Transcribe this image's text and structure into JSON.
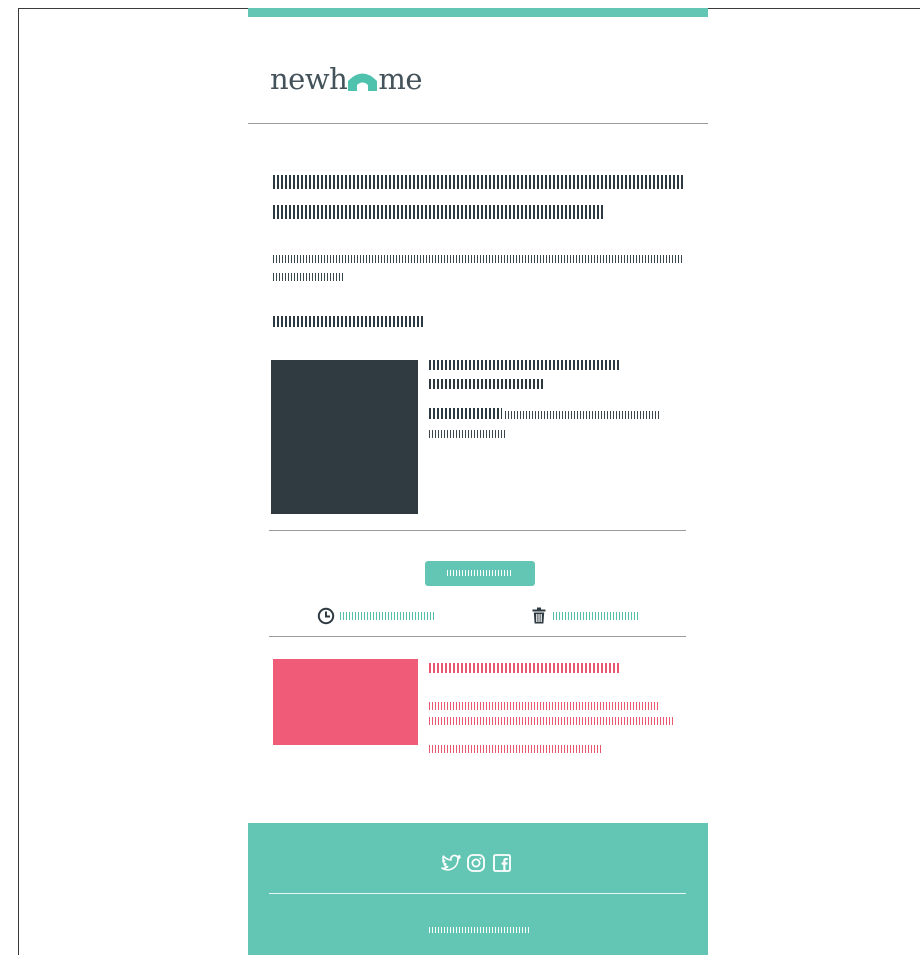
{
  "brand": {
    "logo_prefix": "newh",
    "logo_suffix": "me",
    "logo_icon": "house-icon",
    "accent_color": "#63c5b3",
    "dark_color": "#2f3a41",
    "promo_color": "#f05c78"
  },
  "email": {
    "headline_line1": "",
    "headline_line2": "",
    "intro_line1": "",
    "intro_line2": "",
    "section_label": "",
    "listing": {
      "title_line1": "",
      "title_line2": "",
      "price": "",
      "detail_line1": "",
      "detail_line2": ""
    },
    "cta_label": "",
    "actions": [
      {
        "icon": "clock-icon",
        "label": ""
      },
      {
        "icon": "trash-icon",
        "label": ""
      }
    ],
    "promo": {
      "title": "",
      "body_line1": "",
      "body_line2": "",
      "link": ""
    }
  },
  "footer": {
    "social_icons": [
      "twitter-icon",
      "instagram-icon",
      "facebook-icon"
    ],
    "legal_text": ""
  }
}
